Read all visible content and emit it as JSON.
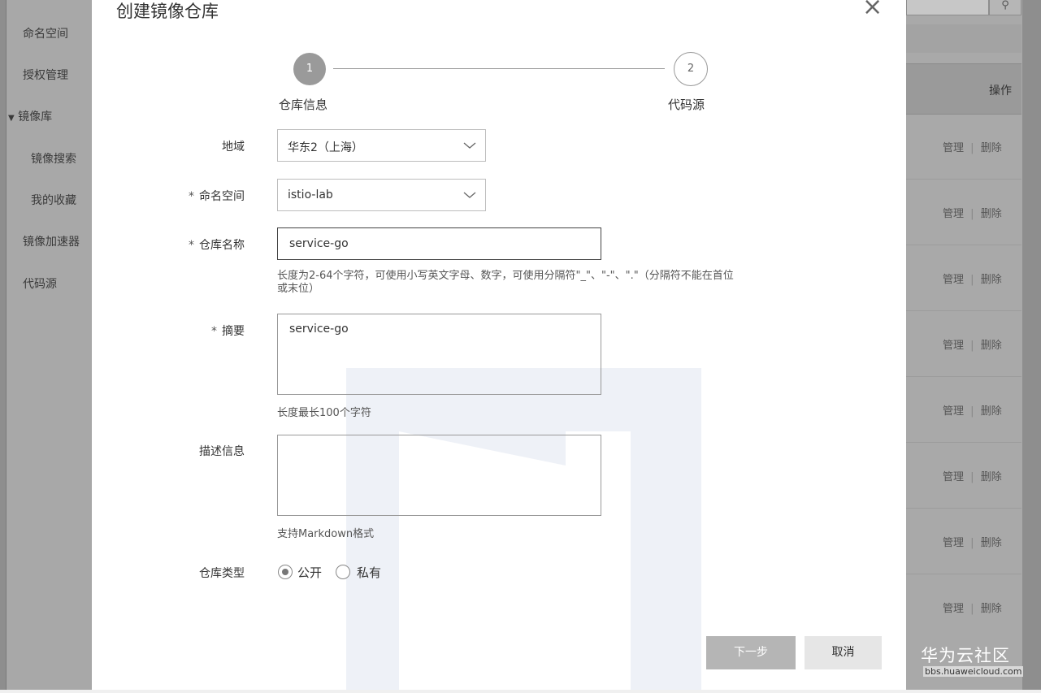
{
  "sidebar": {
    "items": [
      {
        "label": "命名空间"
      },
      {
        "label": "授权管理"
      },
      {
        "label": "镜像库",
        "arrow": "▼"
      },
      {
        "label": "镜像搜索"
      },
      {
        "label": "我的收藏"
      },
      {
        "label": "镜像加速器"
      },
      {
        "label": "代码源"
      }
    ]
  },
  "background": {
    "search_icon": "⚲",
    "column_header": "操作",
    "row_actions": {
      "manage": "管理",
      "separator": "|",
      "delete": "删除"
    }
  },
  "modal": {
    "title": "创建镜像仓库",
    "close_icon": "×",
    "steps": [
      {
        "number": "1",
        "label": "仓库信息",
        "state": "active"
      },
      {
        "number": "2",
        "label": "代码源",
        "state": "pending"
      }
    ],
    "fields": {
      "region": {
        "label": "地域",
        "value": "华东2（上海）"
      },
      "namespace": {
        "label": "命名空间",
        "required_mark": "*",
        "value": "istio-lab"
      },
      "repo_name": {
        "label": "仓库名称",
        "required_mark": "*",
        "value": "service-go",
        "hint_line1": "长度为2-64个字符，可使用小写英文字母、数字，可使用分隔符\"_\"、\"-\"、\".\"（分隔符不能在首位",
        "hint_line2": "或末位）"
      },
      "summary": {
        "label": "摘要",
        "required_mark": "*",
        "value": "service-go",
        "hint": "长度最长100个字符"
      },
      "description": {
        "label": "描述信息",
        "value": "",
        "hint": "支持Markdown格式"
      },
      "repo_type": {
        "label": "仓库类型",
        "options": [
          {
            "label": "公开",
            "checked": true
          },
          {
            "label": "私有",
            "checked": false
          }
        ]
      }
    },
    "buttons": {
      "next": "下一步",
      "cancel": "取消"
    }
  },
  "watermark": {
    "brand": "华为云社区",
    "url": "bbs.huaweicloud.com"
  }
}
